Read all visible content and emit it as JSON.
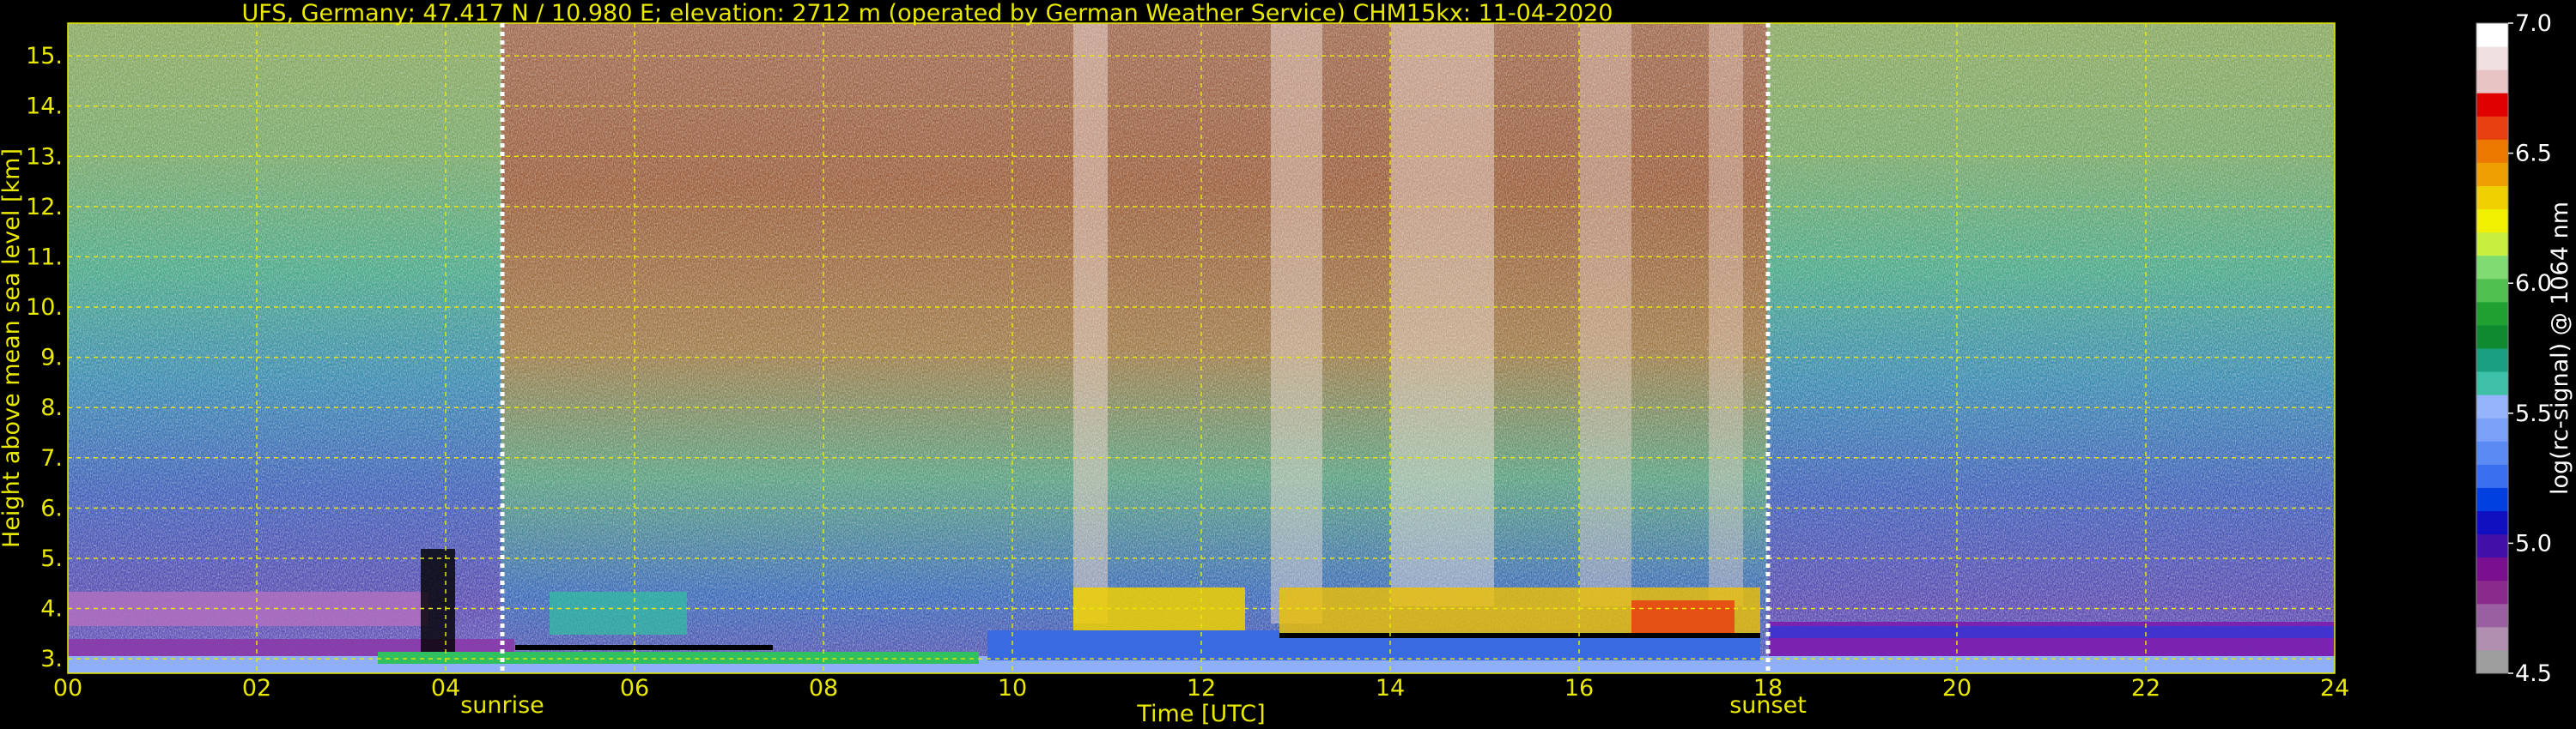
{
  "chart_data": {
    "type": "heatmap",
    "title": "UFS, Germany; 47.417 N / 10.980 E; elevation: 2712 m  (operated by German Weather Service)    CHM15kx: 11-04-2020",
    "xlabel": "Time [UTC]",
    "ylabel": "Height above mean sea level [km]",
    "xlim": [
      0,
      24
    ],
    "ylim": [
      2.712,
      15.65
    ],
    "x_ticks": [
      "00",
      "02",
      "04",
      "06",
      "08",
      "10",
      "12",
      "14",
      "16",
      "18",
      "20",
      "22",
      "24"
    ],
    "y_ticks": [
      "3.",
      "4.",
      "5.",
      "6.",
      "7.",
      "8.",
      "9.",
      "10.",
      "11.",
      "12.",
      "13.",
      "14.",
      "15."
    ],
    "grid": true,
    "annotations": [
      {
        "label": "sunrise",
        "time": 4.6
      },
      {
        "label": "sunset",
        "time": 18.0
      }
    ],
    "colorbar": {
      "label": "log(rc-signal) @ 1064 nm",
      "range": [
        4.5,
        7.0
      ],
      "ticks": [
        "4.5",
        "5.0",
        "5.5",
        "6.0",
        "6.5",
        "7.0"
      ],
      "colors": [
        "#9e9e9e",
        "#b08fb0",
        "#9a5fa0",
        "#8a2a8a",
        "#7a1090",
        "#4010a8",
        "#1010c0",
        "#0040e0",
        "#3a70f0",
        "#5a8af4",
        "#7aa0f8",
        "#95b4fb",
        "#3ec0a8",
        "#1aa080",
        "#108a30",
        "#20a030",
        "#50c050",
        "#80dc70",
        "#c8ee40",
        "#f0f000",
        "#f0d000",
        "#eea000",
        "#ec7800",
        "#e84010",
        "#e00000",
        "#e8c4c4",
        "#f0e0e0",
        "#ffffff"
      ]
    }
  }
}
